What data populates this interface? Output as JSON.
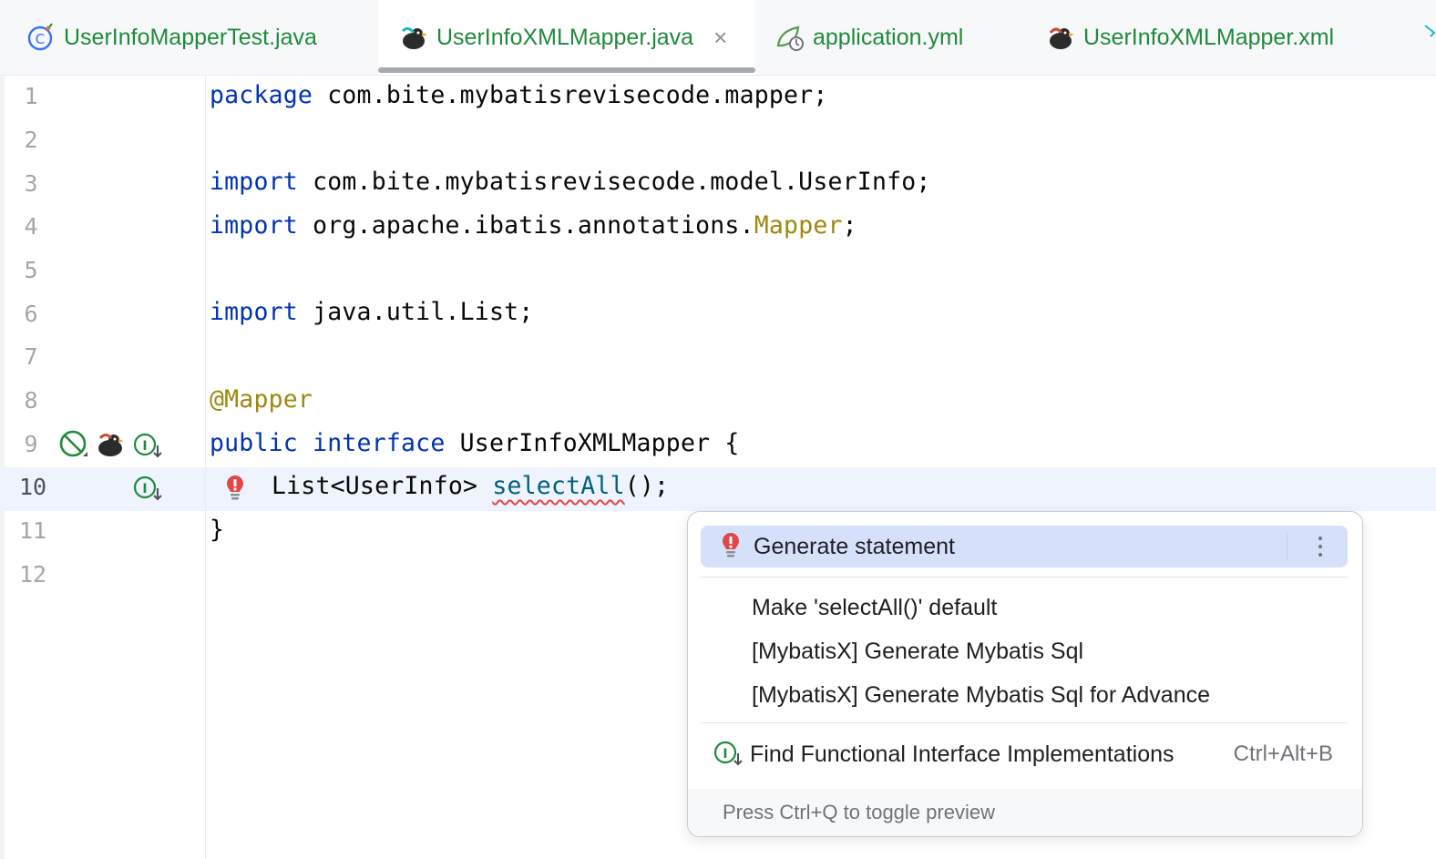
{
  "tabs": [
    {
      "label": "UserInfoMapperTest.java",
      "icon": "test-class-icon",
      "active": false
    },
    {
      "label": "UserInfoXMLMapper.java",
      "icon": "mybatis-bird-icon",
      "active": true,
      "close": "×"
    },
    {
      "label": "application.yml",
      "icon": "spring-config-icon",
      "active": false
    },
    {
      "label": "UserInfoXMLMapper.xml",
      "icon": "mybatis-bird-icon",
      "active": false
    }
  ],
  "editor": {
    "line_numbers": [
      "1",
      "2",
      "3",
      "4",
      "5",
      "6",
      "7",
      "8",
      "9",
      "10",
      "11",
      "12"
    ],
    "current_line": "10",
    "code": {
      "l1_kw": "package",
      "l1_rest": " com.bite.mybatisrevisecode.mapper;",
      "l3_kw": "import",
      "l3_rest": " com.bite.mybatisrevisecode.model.UserInfo;",
      "l4_kw": "import",
      "l4_mid": " org.apache.ibatis.annotations.",
      "l4_ann": "Mapper",
      "l4_end": ";",
      "l6_kw": "import",
      "l6_rest": " java.util.List;",
      "l8_ann": "@Mapper",
      "l9_kw1": "public",
      "l9_kw2": " interface",
      "l9_rest": " UserInfoXMLMapper {",
      "l10_type": "List<UserInfo> ",
      "l10_method": "selectAll",
      "l10_end": "();",
      "l11": "}"
    },
    "gutter_icons": [
      "disabled-icon",
      "mybatis-bird-icon",
      "implementations-icon",
      "implementations-icon",
      "error-bulb-icon"
    ]
  },
  "popup": {
    "items": [
      {
        "label": "Generate statement",
        "icon": "error-bulb-icon",
        "selected": true
      },
      {
        "label": "Make 'selectAll()' default"
      },
      {
        "label": "[MybatisX] Generate Mybatis Sql"
      },
      {
        "label": "[MybatisX] Generate Mybatis Sql for Advance"
      },
      {
        "label": "Find Functional Interface Implementations",
        "icon": "implementations-icon",
        "shortcut": "Ctrl+Alt+B"
      }
    ],
    "footer": "Press Ctrl+Q to toggle preview"
  },
  "colors": {
    "tab_text": "#208a3c",
    "keyword": "#0033b3",
    "annotation": "#9e880d",
    "method": "#00627a",
    "error": "#e54545",
    "selection": "#d5e1fb"
  }
}
